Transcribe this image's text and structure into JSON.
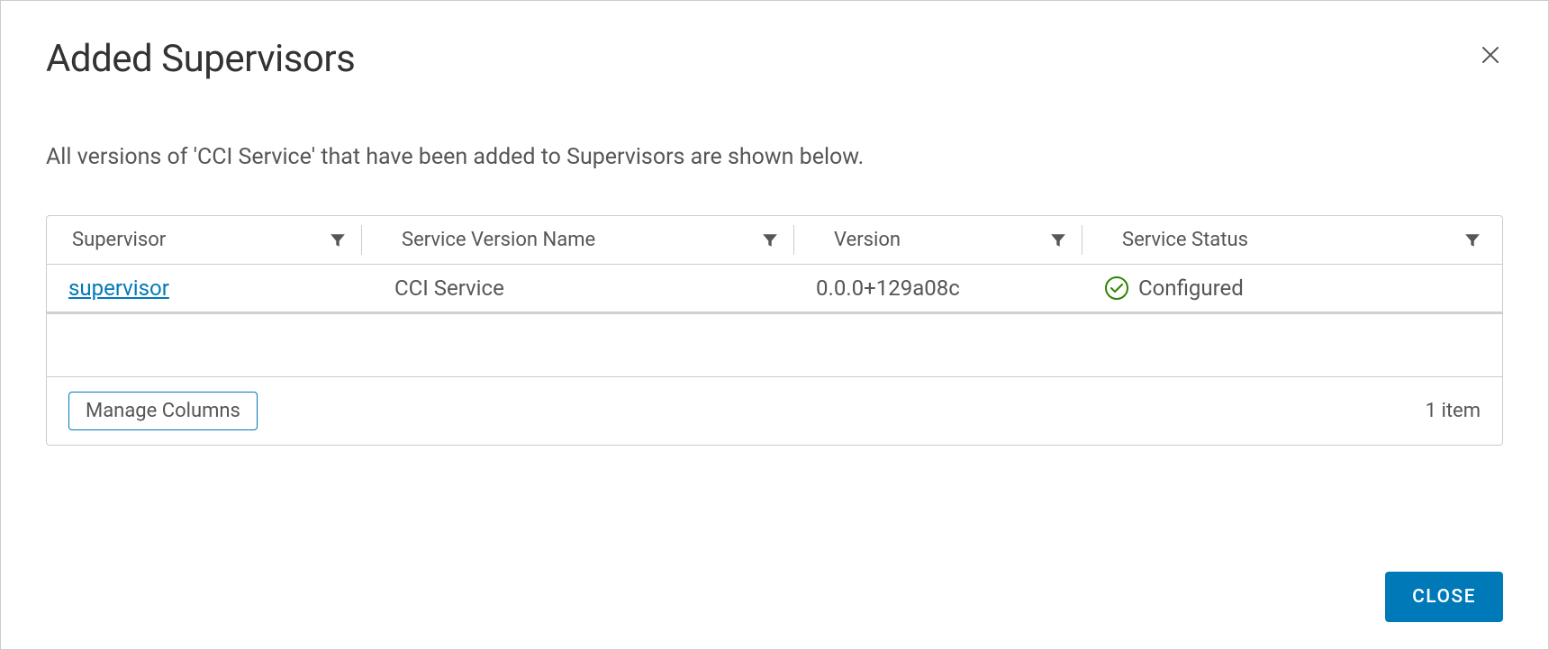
{
  "modal": {
    "title": "Added Supervisors",
    "description": "All versions of 'CCI Service' that have been added to Supervisors are shown below.",
    "close_button_label": "CLOSE"
  },
  "table": {
    "columns": {
      "supervisor": "Supervisor",
      "service_version_name": "Service Version Name",
      "version": "Version",
      "service_status": "Service Status"
    },
    "rows": [
      {
        "supervisor": "supervisor",
        "service_version_name": "CCI Service",
        "version": "0.0.0+129a08c",
        "service_status": "Configured",
        "status_icon": "check-circle-icon",
        "status_color": "#2f8400"
      }
    ],
    "manage_columns_label": "Manage Columns",
    "item_count_label": "1 item"
  }
}
